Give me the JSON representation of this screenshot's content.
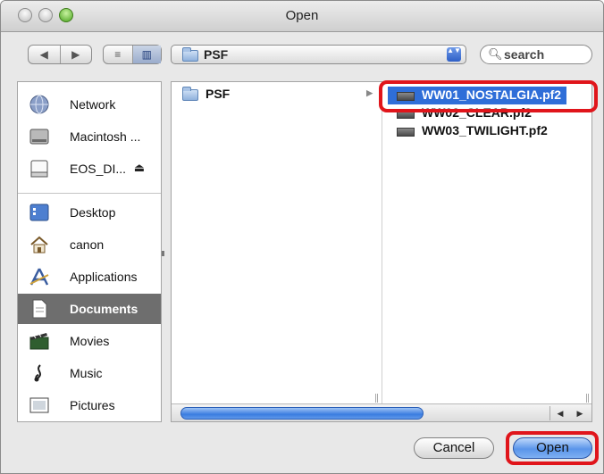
{
  "window": {
    "title": "Open"
  },
  "toolbar": {
    "back": "◀",
    "forward": "▶",
    "view_list": "≡",
    "view_columns": "▥",
    "location": "PSF",
    "location_arrows": "▲▼",
    "search_placeholder": "search"
  },
  "sidebar": {
    "devices": [
      {
        "label": "Network",
        "icon": "network-globe-icon"
      },
      {
        "label": "Macintosh ...",
        "icon": "hard-disk-icon"
      },
      {
        "label": "EOS_DI...",
        "icon": "removable-disk-icon",
        "eject": "⏏"
      }
    ],
    "places": [
      {
        "label": "Desktop",
        "icon": "desktop-icon"
      },
      {
        "label": "canon",
        "icon": "home-icon"
      },
      {
        "label": "Applications",
        "icon": "applications-icon"
      },
      {
        "label": "Documents",
        "icon": "documents-icon",
        "selected": true
      },
      {
        "label": "Movies",
        "icon": "movies-icon"
      },
      {
        "label": "Music",
        "icon": "music-icon"
      },
      {
        "label": "Pictures",
        "icon": "pictures-icon"
      }
    ]
  },
  "browser": {
    "column1": [
      {
        "label": "PSF",
        "expandable": true
      }
    ],
    "column2": [
      {
        "label": "WW01_NOSTALGIA.pf2",
        "selected": true
      },
      {
        "label": "WW02_CLEAR.pf2"
      },
      {
        "label": "WW03_TWILIGHT.pf2"
      }
    ]
  },
  "buttons": {
    "cancel": "Cancel",
    "open": "Open"
  },
  "colors": {
    "selection": "#2f6ed8",
    "highlight_annotation": "#e0151b",
    "sidebar_selected": "#6e6e6e"
  }
}
